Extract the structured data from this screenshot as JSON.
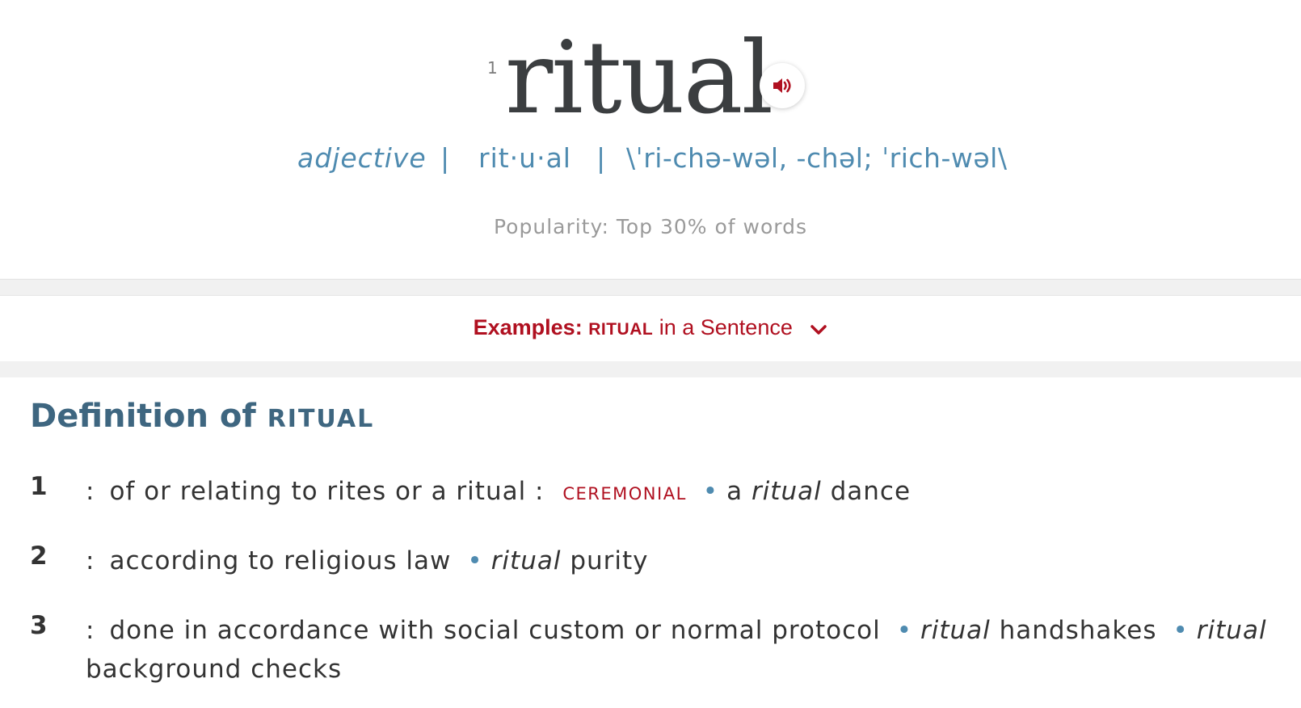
{
  "entry": {
    "homograph_number": "1",
    "headword": "ritual",
    "part_of_speech": "adjective",
    "separator": "|",
    "syllables": "rit·u·al",
    "pronunciation": "\\ˈri-chə-wəl, -chəl; ˈrich-wəl\\",
    "popularity": "Popularity: Top 30% of words",
    "audio_icon": "speaker-icon"
  },
  "examples": {
    "label_bold": "Examples:",
    "word": "RITUAL",
    "label_rest": " in a Sentence",
    "toggle_icon": "chevron-down-icon"
  },
  "definition": {
    "heading": "Definition of ",
    "word": "RITUAL",
    "senses": [
      {
        "num": "1",
        "colon": ":",
        "text": "of or relating to rites or a ritual :",
        "synonym": "CEREMONIAL",
        "examples": [
          {
            "pre": "a ",
            "italic": "ritual",
            "post": " dance"
          }
        ]
      },
      {
        "num": "2",
        "colon": ":",
        "text": "according to religious law",
        "examples": [
          {
            "pre": "",
            "italic": "ritual",
            "post": " purity"
          }
        ]
      },
      {
        "num": "3",
        "colon": ":",
        "text": "done in accordance with social custom or normal protocol",
        "examples": [
          {
            "pre": "",
            "italic": "ritual",
            "post": " handshakes"
          },
          {
            "pre": "",
            "italic": "ritual",
            "post": " background checks"
          }
        ]
      }
    ]
  },
  "colors": {
    "headword": "#3b3e40",
    "link_blue": "#4f8bb0",
    "heading_blue": "#3e6680",
    "accent_red": "#b01020",
    "muted_gray": "#9a9a9a"
  }
}
